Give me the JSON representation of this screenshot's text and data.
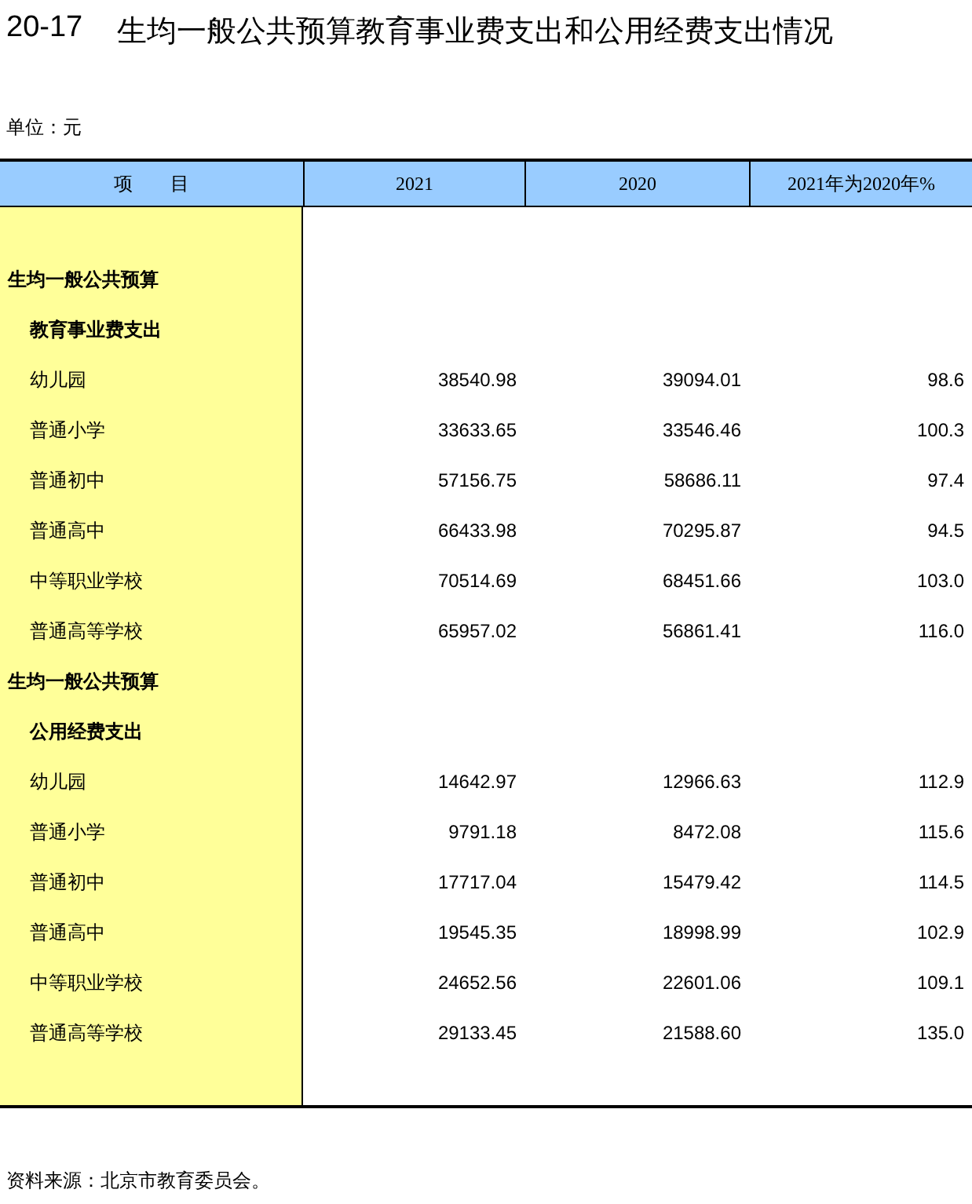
{
  "title": {
    "number": "20-17",
    "text": "生均一般公共预算教育事业费支出和公用经费支出情况"
  },
  "unit": "单位：元",
  "table": {
    "columns": [
      "项　　目",
      "2021",
      "2020",
      "2021年为2020年%"
    ],
    "rows": [
      {
        "kind": "section",
        "label": "生均一般公共预算"
      },
      {
        "kind": "subsection",
        "label": "教育事业费支出"
      },
      {
        "kind": "item",
        "label": "幼儿园",
        "values": [
          "38540.98",
          "39094.01",
          "98.6"
        ]
      },
      {
        "kind": "item",
        "label": "普通小学",
        "values": [
          "33633.65",
          "33546.46",
          "100.3"
        ]
      },
      {
        "kind": "item",
        "label": "普通初中",
        "values": [
          "57156.75",
          "58686.11",
          "97.4"
        ]
      },
      {
        "kind": "item",
        "label": "普通高中",
        "values": [
          "66433.98",
          "70295.87",
          "94.5"
        ]
      },
      {
        "kind": "item",
        "label": "中等职业学校",
        "values": [
          "70514.69",
          "68451.66",
          "103.0"
        ]
      },
      {
        "kind": "item",
        "label": "普通高等学校",
        "values": [
          "65957.02",
          "56861.41",
          "116.0"
        ]
      },
      {
        "kind": "section",
        "label": "生均一般公共预算"
      },
      {
        "kind": "subsection",
        "label": "公用经费支出"
      },
      {
        "kind": "item",
        "label": "幼儿园",
        "values": [
          "14642.97",
          "12966.63",
          "112.9"
        ]
      },
      {
        "kind": "item",
        "label": "普通小学",
        "values": [
          "9791.18",
          "8472.08",
          "115.6"
        ]
      },
      {
        "kind": "item",
        "label": "普通初中",
        "values": [
          "17717.04",
          "15479.42",
          "114.5"
        ]
      },
      {
        "kind": "item",
        "label": "普通高中",
        "values": [
          "19545.35",
          "18998.99",
          "102.9"
        ]
      },
      {
        "kind": "item",
        "label": "中等职业学校",
        "values": [
          "24652.56",
          "22601.06",
          "109.1"
        ]
      },
      {
        "kind": "item",
        "label": "普通高等学校",
        "values": [
          "29133.45",
          "21588.60",
          "135.0"
        ]
      }
    ]
  },
  "source": "资料来源：北京市教育委员会。"
}
